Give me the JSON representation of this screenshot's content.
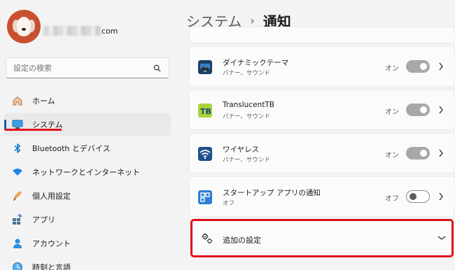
{
  "account": {
    "email_suffix": "com"
  },
  "search": {
    "placeholder": "設定の検索"
  },
  "nav": {
    "items": [
      {
        "label": "ホーム",
        "icon": "home-icon"
      },
      {
        "label": "システム",
        "icon": "system-icon",
        "active": true
      },
      {
        "label": "Bluetooth とデバイス",
        "icon": "bluetooth-icon"
      },
      {
        "label": "ネットワークとインターネット",
        "icon": "wifi-icon"
      },
      {
        "label": "個人用設定",
        "icon": "brush-icon"
      },
      {
        "label": "アプリ",
        "icon": "apps-icon"
      },
      {
        "label": "アカウント",
        "icon": "account-icon"
      },
      {
        "label": "時刻と言語",
        "icon": "globe-clock-icon"
      }
    ]
  },
  "header": {
    "parent": "システム",
    "separator": "›",
    "current": "通知"
  },
  "apps": [
    {
      "title": "ダイナミックテーマ",
      "subtitle": "バナー、サウンド",
      "state": "オン",
      "on": true
    },
    {
      "title": "TranslucentTB",
      "subtitle": "バナー、サウンド",
      "state": "オン",
      "on": true
    },
    {
      "title": "ワイヤレス",
      "subtitle": "バナー、サウンド",
      "state": "オン",
      "on": true
    },
    {
      "title": "スタートアップ アプリの通知",
      "subtitle": "オフ",
      "state": "オフ",
      "on": false
    }
  ],
  "extra": {
    "label": "追加の設定"
  },
  "colors": {
    "accent": "#005fb8",
    "highlight_red": "#e0101a"
  }
}
